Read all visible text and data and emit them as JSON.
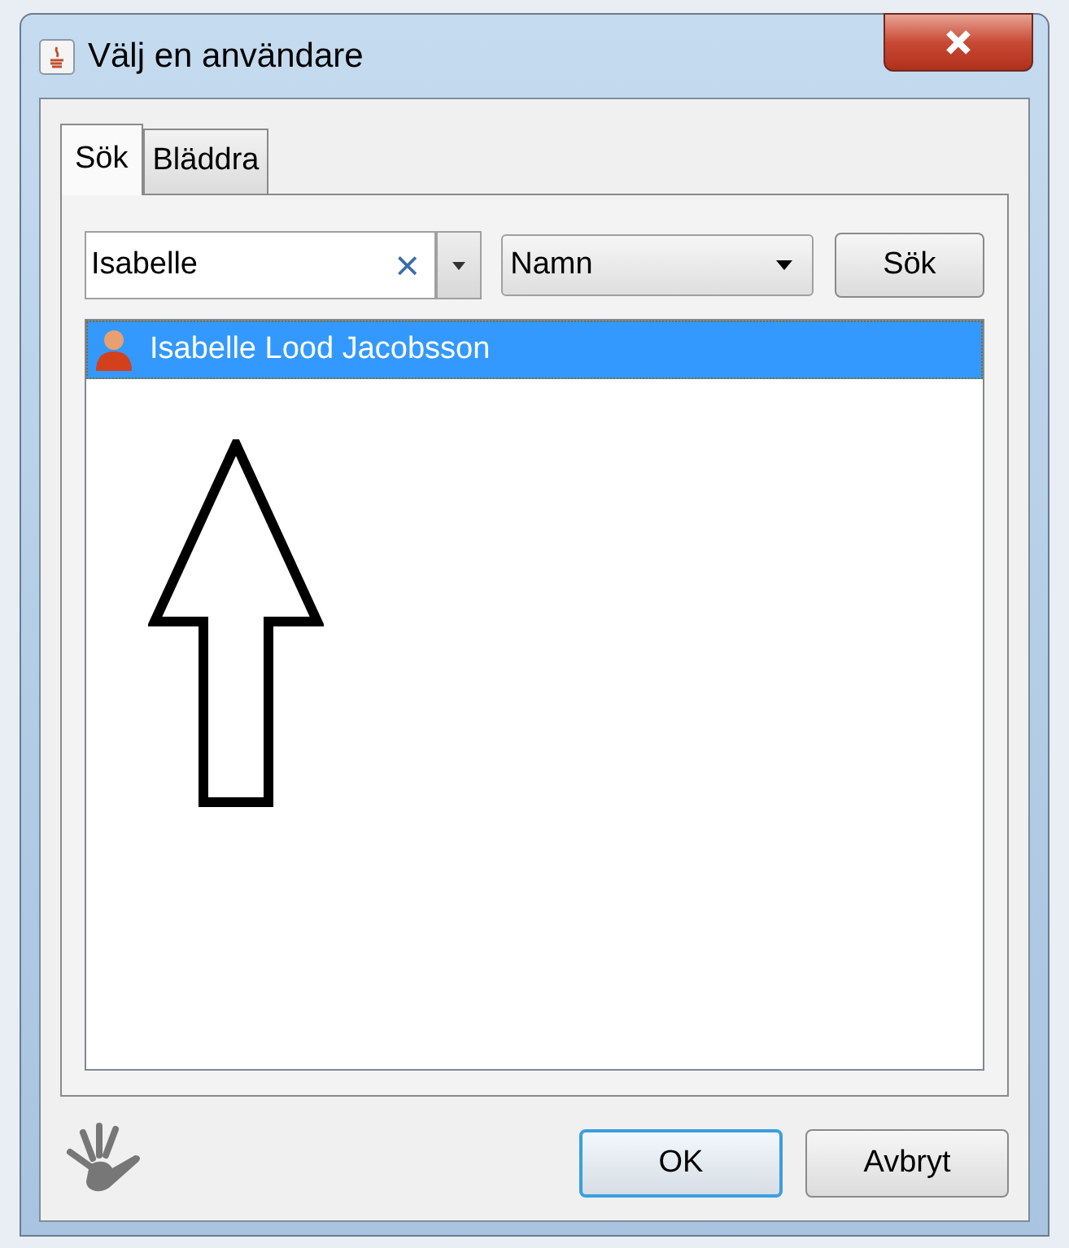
{
  "window": {
    "title": "Välj en användare"
  },
  "tabs": [
    {
      "label": "Sök",
      "selected": true
    },
    {
      "label": "Bläddra",
      "selected": false
    }
  ],
  "search": {
    "value": "Isabelle",
    "clear": "×"
  },
  "field_select": {
    "value": "Namn"
  },
  "search_button": "Sök",
  "results": [
    {
      "name": "Isabelle Lood Jacobsson",
      "selected": true
    }
  ],
  "buttons": [
    {
      "label": "OK",
      "kind": "default"
    },
    {
      "label": "Avbryt",
      "kind": "normal"
    }
  ]
}
